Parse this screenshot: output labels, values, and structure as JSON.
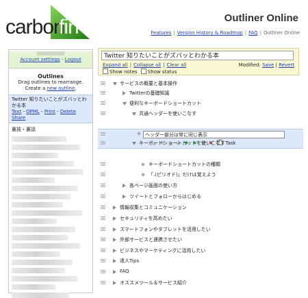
{
  "header": {
    "logo_left": "carbon",
    "logo_right": "fin",
    "title": "Outliner Online",
    "nav": [
      "Features",
      "Version History & Roadmap",
      "FAQ",
      "Outliner Online"
    ]
  },
  "sidebar": {
    "account_settings": "Account settings",
    "logout": "Logout",
    "dash": "-",
    "outlines_heading": "Outlines",
    "drag_hint": "Drag outlines to rearrange.",
    "create_prefix": "Create a",
    "new_outline": "new outline",
    "selected_title": "Twitter 知りたいことがズバッとわかる本",
    "actions": [
      "Text",
      "OPML",
      "Print",
      "Delete",
      "Share"
    ],
    "second_item": "裏技・裏話"
  },
  "editor": {
    "title_value": "Twitter 知りたいことがズバッとわかる本",
    "expand_all": "Expand all",
    "collapse_all": "Collapse all",
    "clear_all": "Clear all",
    "modified_label": "Modified:",
    "save": "Save",
    "revert": "Revert",
    "show_notes": "Show notes",
    "show_status": "Show status",
    "task_label": "Task",
    "editing_value": "ヘッダー部分は常に同じ表示"
  },
  "outline_rows": [
    {
      "text": "サービスの概要と基本操作",
      "level": 0,
      "state": "open"
    },
    {
      "text": "Twitterの基礎知識",
      "level": 1,
      "state": "closed"
    },
    {
      "text": "便利なキーボードショートカット",
      "level": 1,
      "state": "open"
    },
    {
      "text": "共通ヘッダーを使いこなす",
      "level": 2,
      "state": "open"
    },
    {
      "text": "キーボードショートカットを使いこなす",
      "level": 2,
      "state": "open"
    },
    {
      "text": "キーボードショートカットの種類",
      "level": 3,
      "state": "leaf"
    },
    {
      "text": "「.(ピリオド)」だけは覚えよう",
      "level": 3,
      "state": "leaf"
    },
    {
      "text": "各ページ画面の使い方",
      "level": 1,
      "state": "closed"
    },
    {
      "text": "ツイートとフォローからはじめる",
      "level": 1,
      "state": "closed"
    },
    {
      "text": "情報収集とコミュニケーション",
      "level": 0,
      "state": "closed"
    },
    {
      "text": "セキュリティを高めたい",
      "level": 0,
      "state": "closed"
    },
    {
      "text": "スマートフォンやタブレットを活用したい",
      "level": 0,
      "state": "closed"
    },
    {
      "text": "外部サービスと連携させたい",
      "level": 0,
      "state": "closed"
    },
    {
      "text": "ビジネスやマーケティングに活用したい",
      "level": 0,
      "state": "closed"
    },
    {
      "text": "達人Tips",
      "level": 0,
      "state": "closed"
    },
    {
      "text": "FAQ",
      "level": 0,
      "state": "closed"
    },
    {
      "text": "オススメツール＆サービス紹介",
      "level": 0,
      "state": "closed"
    }
  ],
  "colors": {
    "accent_green": "#2f8f1a",
    "link_blue": "#1a3fb0",
    "selection_blue": "#dde9fb",
    "title_yellow": "#fbf8d4",
    "account_green": "#e4f3d4"
  }
}
